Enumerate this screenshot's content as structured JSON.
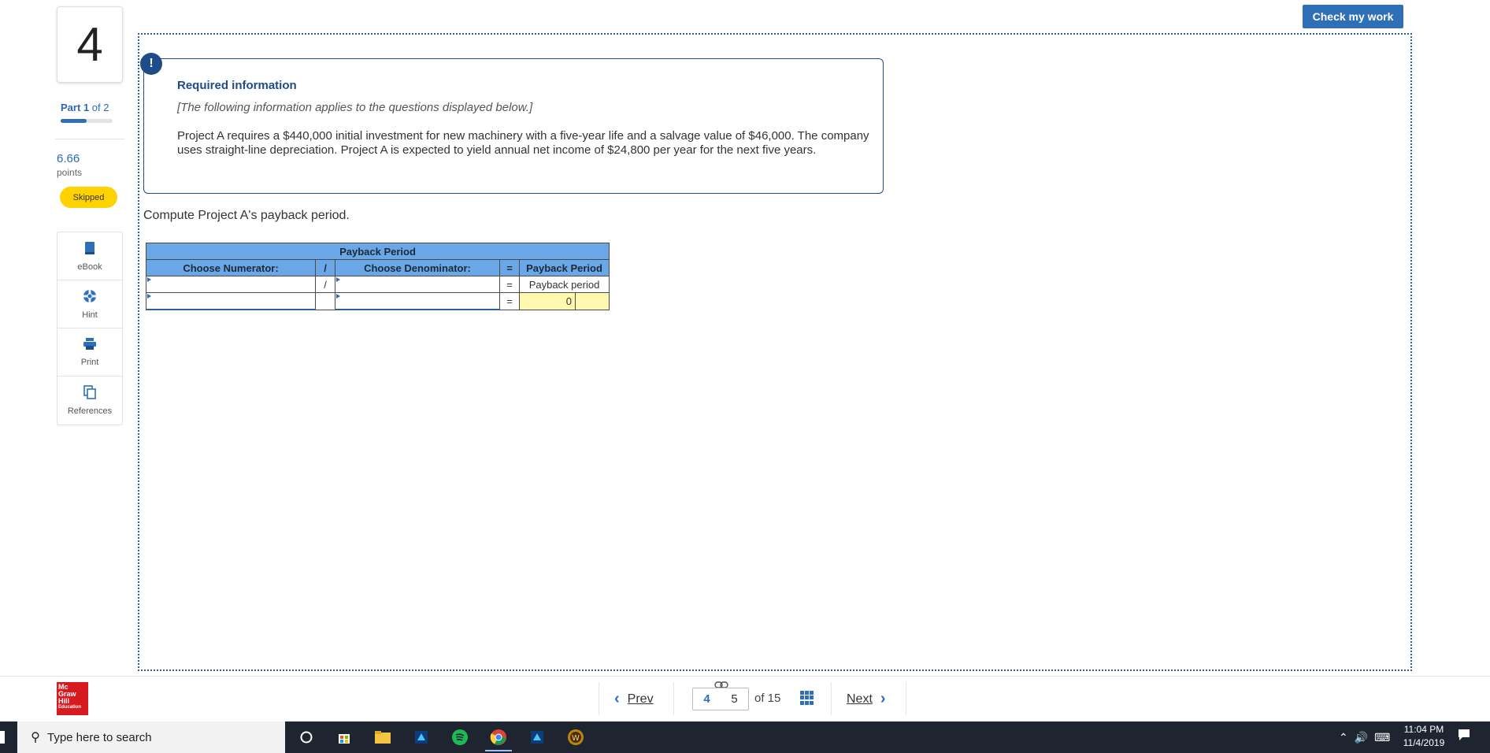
{
  "header": {
    "check_button": "Check my work"
  },
  "sidebar": {
    "question_number": "4",
    "part_label": "Part",
    "part_current": "1",
    "part_of": "of 2",
    "progress_fraction": 0.5,
    "points_value": "6.66",
    "points_label": "points",
    "status_badge": "Skipped",
    "tools": [
      {
        "label": "eBook",
        "icon": "book-icon"
      },
      {
        "label": "Hint",
        "icon": "lifebuoy-icon"
      },
      {
        "label": "Print",
        "icon": "printer-icon"
      },
      {
        "label": "References",
        "icon": "copy-icon"
      }
    ]
  },
  "info": {
    "badge": "!",
    "title": "Required information",
    "italic_note": "[The following information applies to the questions displayed below.]",
    "body": "Project A requires a $440,000 initial investment for new machinery with a five-year life and a salvage value of $46,000. The company uses straight-line depreciation. Project A is expected to yield annual net income of $24,800 per year for the next five years."
  },
  "question": "Compute Project A's payback period.",
  "table": {
    "title": "Payback Period",
    "col_numerator": "Choose Numerator:",
    "col_divide": "/",
    "col_denominator": "Choose Denominator:",
    "col_equals": "=",
    "col_result": "Payback Period",
    "row1": {
      "numerator": "",
      "divide": "/",
      "denominator": "",
      "equals": "=",
      "result": "Payback period"
    },
    "row2": {
      "numerator": "",
      "divide": "",
      "denominator": "",
      "equals": "=",
      "result": "0"
    }
  },
  "footer": {
    "logo_lines": [
      "Mc",
      "Graw",
      "Hill",
      "Education"
    ],
    "prev_label": "Prev",
    "next_label": "Next",
    "page_current": "4",
    "page_next": "5",
    "page_total": "of 15"
  },
  "taskbar": {
    "search_placeholder": "Type here to search",
    "time": "11:04 PM",
    "date": "11/4/2019"
  },
  "colors": {
    "accent": "#2f6fb6",
    "info_border": "#1e4b8a",
    "badge_yellow": "#ffd200",
    "table_header": "#6aa7e6"
  }
}
